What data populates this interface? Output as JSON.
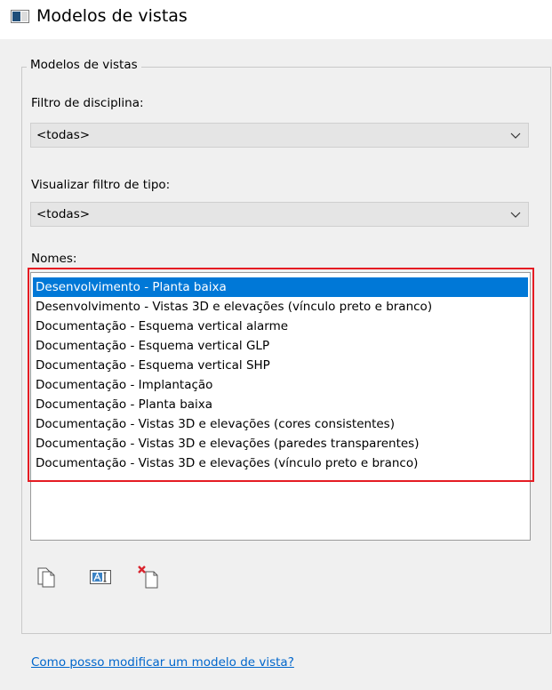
{
  "window": {
    "title": "Modelos de vistas"
  },
  "group": {
    "legend": "Modelos de vistas"
  },
  "discipline_filter": {
    "label": "Filtro de disciplina:",
    "value": "<todas>"
  },
  "type_filter": {
    "label": "Visualizar filtro de tipo:",
    "value": "<todas>"
  },
  "names": {
    "label": "Nomes:",
    "items": [
      "Desenvolvimento - Planta baixa",
      "Desenvolvimento - Vistas 3D e elevações (vínculo preto e branco)",
      "Documentação - Esquema vertical alarme",
      "Documentação - Esquema vertical GLP",
      "Documentação - Esquema vertical SHP",
      "Documentação - Implantação",
      "Documentação - Planta baixa",
      "Documentação - Vistas 3D e elevações (cores consistentes)",
      "Documentação - Vistas 3D e elevações (paredes transparentes)",
      "Documentação - Vistas 3D e elevações (vínculo preto e branco)"
    ],
    "selected_index": 0
  },
  "toolbar": {
    "duplicate_icon": "duplicate-icon",
    "rename_icon": "rename-icon",
    "delete_icon": "delete-icon"
  },
  "help": {
    "link_text": "Como posso modificar um modelo de vista?"
  },
  "colors": {
    "selection": "#0078d7",
    "highlight": "#e51c23",
    "link": "#0066cc"
  }
}
